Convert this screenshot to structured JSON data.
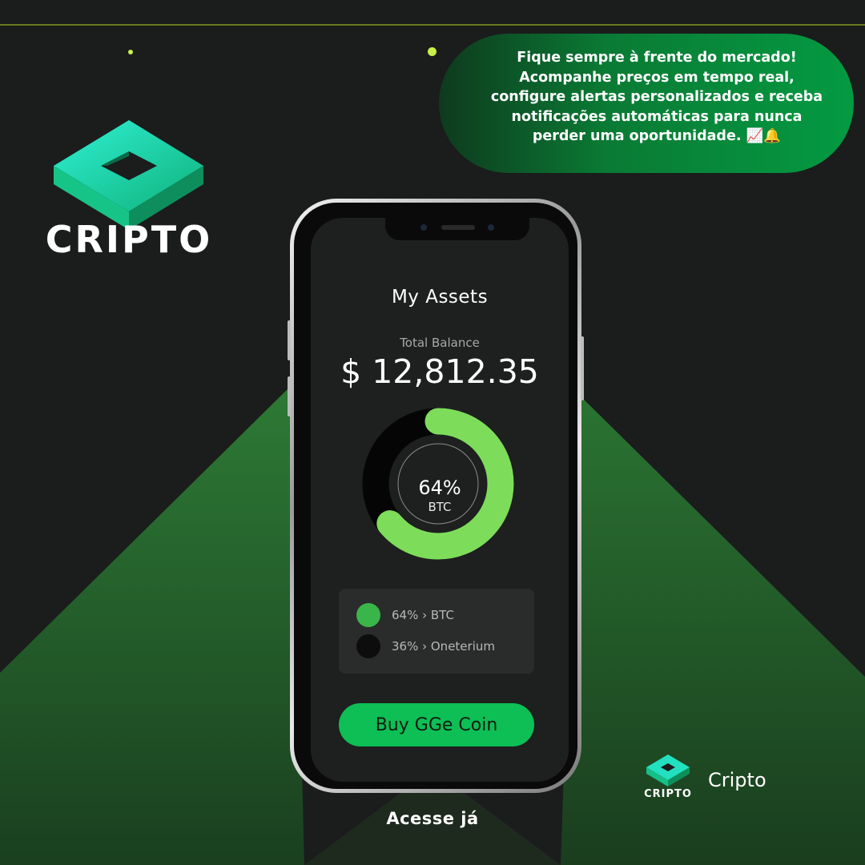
{
  "colors": {
    "background": "#1b1c1c",
    "accent_green": "#0dbf55",
    "donut_green": "#7ddd5a",
    "logo_teal": "#1fe3c8"
  },
  "brand": {
    "logo_text": "CRIPTO",
    "small_logo_text": "CRIPTO",
    "small_brand_name": "Cripto"
  },
  "promo": {
    "text": "Fique sempre à frente do mercado! Acompanhe preços em tempo real, configure alertas personalizados e receba notificações automáticas para nunca perder uma oportunidade. 📈🔔"
  },
  "app": {
    "title": "My Assets",
    "total_label": "Total Balance",
    "total_value": "$ 12,812.35",
    "donut": {
      "percent_label": "64%",
      "asset_label": "BTC",
      "fraction": 0.64
    },
    "legend": [
      {
        "label": "64% › BTC",
        "color": "#3ab54a"
      },
      {
        "label": "36% › Oneterium",
        "color": "#0d0d0d"
      }
    ],
    "buy_button": "Buy GGe Coin"
  },
  "cta": "Acesse já"
}
